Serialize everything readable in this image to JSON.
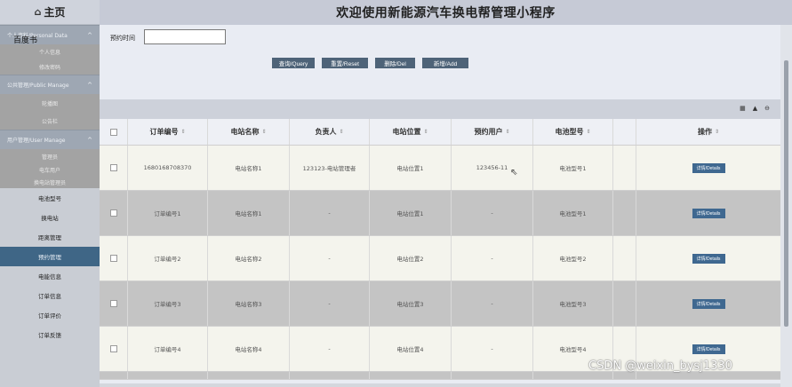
{
  "sidebar": {
    "home_icon": "home-icon",
    "home_label": "主页",
    "bookmark_label": "百度书",
    "groups": [
      {
        "label": "个人资料/Personal Data",
        "items": [
          "个人信息",
          "修改密码"
        ]
      },
      {
        "label": "公共管理/Public Manage",
        "items": [
          "轮播图",
          "公告栏"
        ]
      },
      {
        "label": "用户管理/User Manage",
        "items": [
          "管理员",
          "电车用户",
          "换电站管理员"
        ]
      }
    ],
    "menu": [
      "电池型号",
      "换电站",
      "距离管理",
      "预约管理",
      "电能信息",
      "订单信息",
      "订单评价",
      "订单反馈"
    ],
    "active_index": 3
  },
  "header": {
    "title": "欢迎使用新能源汽车换电帮管理小程序"
  },
  "search": {
    "label": "预约时间",
    "value": ""
  },
  "buttons": {
    "query": "查询/Query",
    "reset": "重置/Reset",
    "delete": "删除/Del",
    "add": "新增/Add"
  },
  "toolbar": {
    "icons": [
      "export-icon",
      "print-icon",
      "settings-icon"
    ]
  },
  "table": {
    "headers": [
      "订单编号",
      "电站名称",
      "负责人",
      "电站位置",
      "预约用户",
      "电池型号",
      "操作"
    ],
    "detail_label": "详情/Details",
    "rows": [
      {
        "order": "1680168708370",
        "station": "电站名称1",
        "manager": "123123-电站管理者",
        "location": "电站位置1",
        "user": "123456-11",
        "battery": "电池型号1"
      },
      {
        "order": "订单编号1",
        "station": "电站名称1",
        "manager": "-",
        "location": "电站位置1",
        "user": "-",
        "battery": "电池型号1"
      },
      {
        "order": "订单编号2",
        "station": "电站名称2",
        "manager": "-",
        "location": "电站位置2",
        "user": "-",
        "battery": "电池型号2"
      },
      {
        "order": "订单编号3",
        "station": "电站名称3",
        "manager": "-",
        "location": "电站位置3",
        "user": "-",
        "battery": "电池型号3"
      },
      {
        "order": "订单编号4",
        "station": "电站名称4",
        "manager": "-",
        "location": "电站位置4",
        "user": "-",
        "battery": "电池型号4"
      }
    ]
  },
  "watermark": "CSDN @weixin_bysj1330"
}
